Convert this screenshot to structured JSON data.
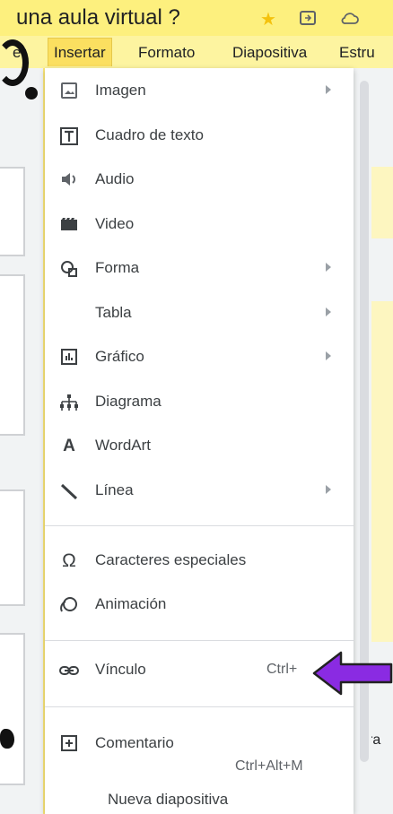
{
  "window": {
    "title": "una aula virtual ?",
    "icons": [
      "star-icon",
      "move-to-folder-icon",
      "cloud-status-icon"
    ],
    "star_color": "#f4c20d"
  },
  "menubar": {
    "items": [
      "er",
      "Insertar",
      "Formato",
      "Diapositiva",
      "Estru"
    ]
  },
  "insert_menu": {
    "items": [
      {
        "label": "Imagen",
        "icon": "image-icon",
        "submenu": true
      },
      {
        "label": "Cuadro de texto",
        "icon": "text-box-icon",
        "submenu": false
      },
      {
        "label": "Audio",
        "icon": "audio-icon",
        "submenu": false
      },
      {
        "label": "Video",
        "icon": "video-icon",
        "submenu": false
      },
      {
        "label": "Forma",
        "icon": "shape-icon",
        "submenu": true
      },
      {
        "label": "Tabla",
        "icon": "",
        "submenu": true
      },
      {
        "label": "Gráfico",
        "icon": "chart-icon",
        "submenu": true
      },
      {
        "label": "Diagrama",
        "icon": "diagram-icon",
        "submenu": false
      },
      {
        "label": "WordArt",
        "icon": "wordart-icon",
        "submenu": false
      },
      {
        "label": "Línea",
        "icon": "line-icon",
        "submenu": true
      },
      {
        "label": "Caracteres especiales",
        "icon": "omega-icon",
        "submenu": false
      },
      {
        "label": "Animación",
        "icon": "animation-icon",
        "submenu": false
      },
      {
        "label": "Vínculo",
        "icon": "link-icon",
        "shortcut": "Ctrl+"
      },
      {
        "label": "Comentario",
        "icon": "comment-add-icon",
        "shortcut": "Ctrl+Alt+M"
      },
      {
        "label": "Nueva diapositiva",
        "icon": "",
        "submenu": false
      }
    ]
  },
  "canvas": {
    "peek_text": "ra"
  },
  "annotation": {
    "arrow_color": "#8a2be2"
  }
}
